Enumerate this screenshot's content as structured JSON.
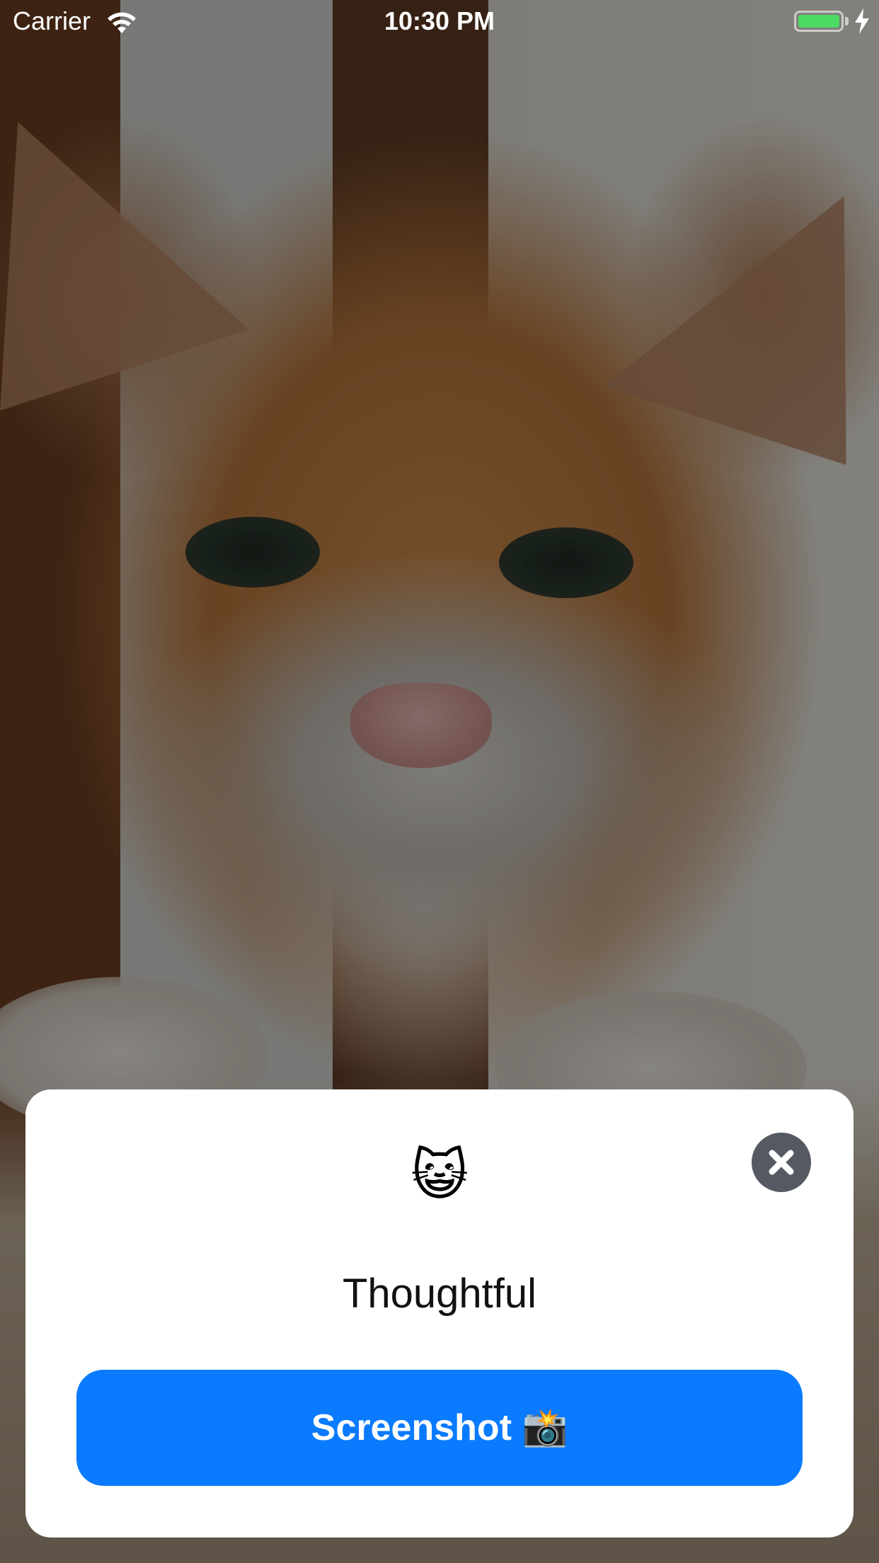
{
  "status_bar": {
    "carrier": "Carrier",
    "time": "10:30 PM",
    "wifi_icon": "wifi-icon",
    "battery_icon": "battery-icon",
    "charging_icon": "lightning-bolt-icon",
    "battery_color": "#4cd964"
  },
  "background": {
    "description_icon": "cat-photo"
  },
  "card": {
    "emoji": "😺",
    "title": "Thoughtful",
    "close_icon": "close-icon",
    "action_button_label": "Screenshot 📸",
    "accent_color": "#0a7bff",
    "close_button_color": "#555a62"
  }
}
